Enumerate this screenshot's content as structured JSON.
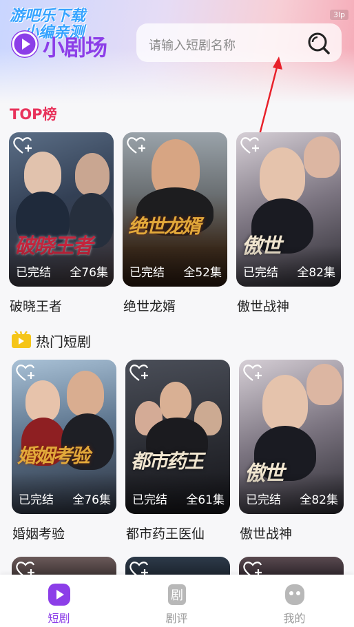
{
  "app": {
    "logo_text": "小剧场",
    "corner_tag": "3lp"
  },
  "watermark": {
    "line1": "游吧乐下载",
    "line2": "小编亲测"
  },
  "search": {
    "placeholder": "请输入短剧名称"
  },
  "colors": {
    "accent": "#8c3ee8",
    "top_title": "#e8335b"
  },
  "sections": {
    "top": {
      "title": "TOP榜",
      "items": [
        {
          "name": "破晓王者",
          "poster_title": "破晓王者",
          "status": "已完结",
          "episodes": "全76集"
        },
        {
          "name": "绝世龙婿",
          "poster_title": "绝世龙婿",
          "status": "已完结",
          "episodes": "全52集"
        },
        {
          "name": "傲世战神",
          "poster_title": "傲世",
          "status": "已完结",
          "episodes": "全82集"
        }
      ]
    },
    "hot": {
      "title": "热门短剧",
      "items": [
        {
          "name": "婚姻考验",
          "poster_title": "婚姻考验",
          "status": "已完结",
          "episodes": "全76集"
        },
        {
          "name": "都市药王医仙",
          "poster_title": "都市药王",
          "status": "已完结",
          "episodes": "全61集"
        },
        {
          "name": "傲世战神",
          "poster_title": "傲世",
          "status": "已完结",
          "episodes": "全82集"
        }
      ]
    }
  },
  "tabbar": {
    "items": [
      {
        "label": "短剧",
        "icon": "play-icon",
        "active": true
      },
      {
        "label": "剧评",
        "icon": "review-icon",
        "active": false
      },
      {
        "label": "我的",
        "icon": "profile-icon",
        "active": false
      }
    ]
  }
}
